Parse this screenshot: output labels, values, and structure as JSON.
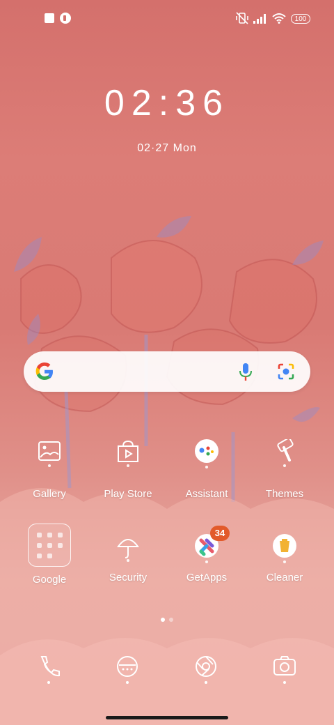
{
  "status_bar": {
    "battery": "100",
    "icons": [
      "stop-square-icon",
      "app-notification-icon",
      "vibrate-off-icon",
      "signal-icon",
      "wifi-icon",
      "battery-icon"
    ]
  },
  "clock": {
    "time": "02:36",
    "date": "02·27  Mon"
  },
  "search": {
    "icons": [
      "google-logo",
      "mic-icon",
      "lens-icon"
    ]
  },
  "apps_row1": [
    {
      "name": "Gallery"
    },
    {
      "name": "Play Store"
    },
    {
      "name": "Assistant"
    },
    {
      "name": "Themes"
    }
  ],
  "apps_row2": [
    {
      "name": "Google"
    },
    {
      "name": "Security"
    },
    {
      "name": "GetApps",
      "badge": "34"
    },
    {
      "name": "Cleaner"
    }
  ],
  "dock": [
    "phone-icon",
    "messages-icon",
    "browser-icon",
    "camera-icon"
  ],
  "pager": {
    "pages": 2,
    "current": 1
  },
  "colors": {
    "badge": "#e25a2a",
    "wallpaper": "#d97a74"
  }
}
